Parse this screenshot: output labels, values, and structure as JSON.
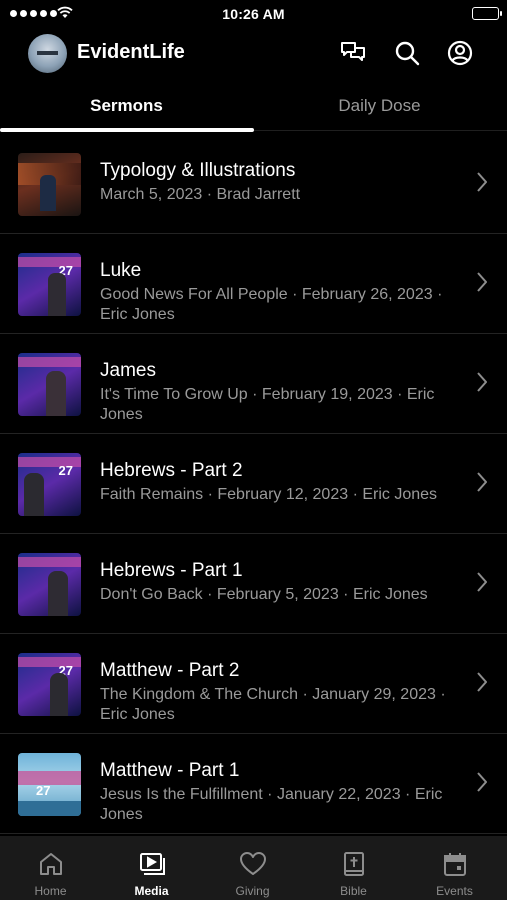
{
  "status_bar": {
    "time": "10:26 AM"
  },
  "header": {
    "app_name": "EvidentLife",
    "icons": [
      "chat-icon",
      "search-icon",
      "account-icon"
    ]
  },
  "tabs": [
    {
      "label": "Sermons",
      "active": true
    },
    {
      "label": "Daily Dose",
      "active": false
    }
  ],
  "sermons": [
    {
      "title": "Typology & Illustrations",
      "subtitle": "March 5, 2023 · Brad Jarrett"
    },
    {
      "title": "Luke",
      "subtitle": "Good News For All People · February 26, 2023 · Eric Jones"
    },
    {
      "title": "James",
      "subtitle": "It's Time To Grow Up · February 19, 2023 · Eric Jones"
    },
    {
      "title": "Hebrews - Part 2",
      "subtitle": "Faith Remains · February 12, 2023 · Eric Jones"
    },
    {
      "title": "Hebrews - Part 1",
      "subtitle": "Don't Go Back · February 5, 2023 · Eric Jones"
    },
    {
      "title": "Matthew - Part 2",
      "subtitle": "The Kingdom & The Church · January 29, 2023 · Eric Jones"
    },
    {
      "title": "Matthew - Part 1",
      "subtitle": "Jesus Is the Fulfillment · January 22, 2023 · Eric Jones"
    }
  ],
  "bottom_nav": [
    {
      "label": "Home",
      "icon": "home-icon",
      "active": false
    },
    {
      "label": "Media",
      "icon": "media-icon",
      "active": true
    },
    {
      "label": "Giving",
      "icon": "heart-icon",
      "active": false
    },
    {
      "label": "Bible",
      "icon": "bible-icon",
      "active": false
    },
    {
      "label": "Events",
      "icon": "calendar-icon",
      "active": false
    }
  ],
  "colors": {
    "background": "#000000",
    "text_primary": "#ffffff",
    "text_secondary": "#9a9a9a",
    "nav_background": "#1a1a1a"
  }
}
